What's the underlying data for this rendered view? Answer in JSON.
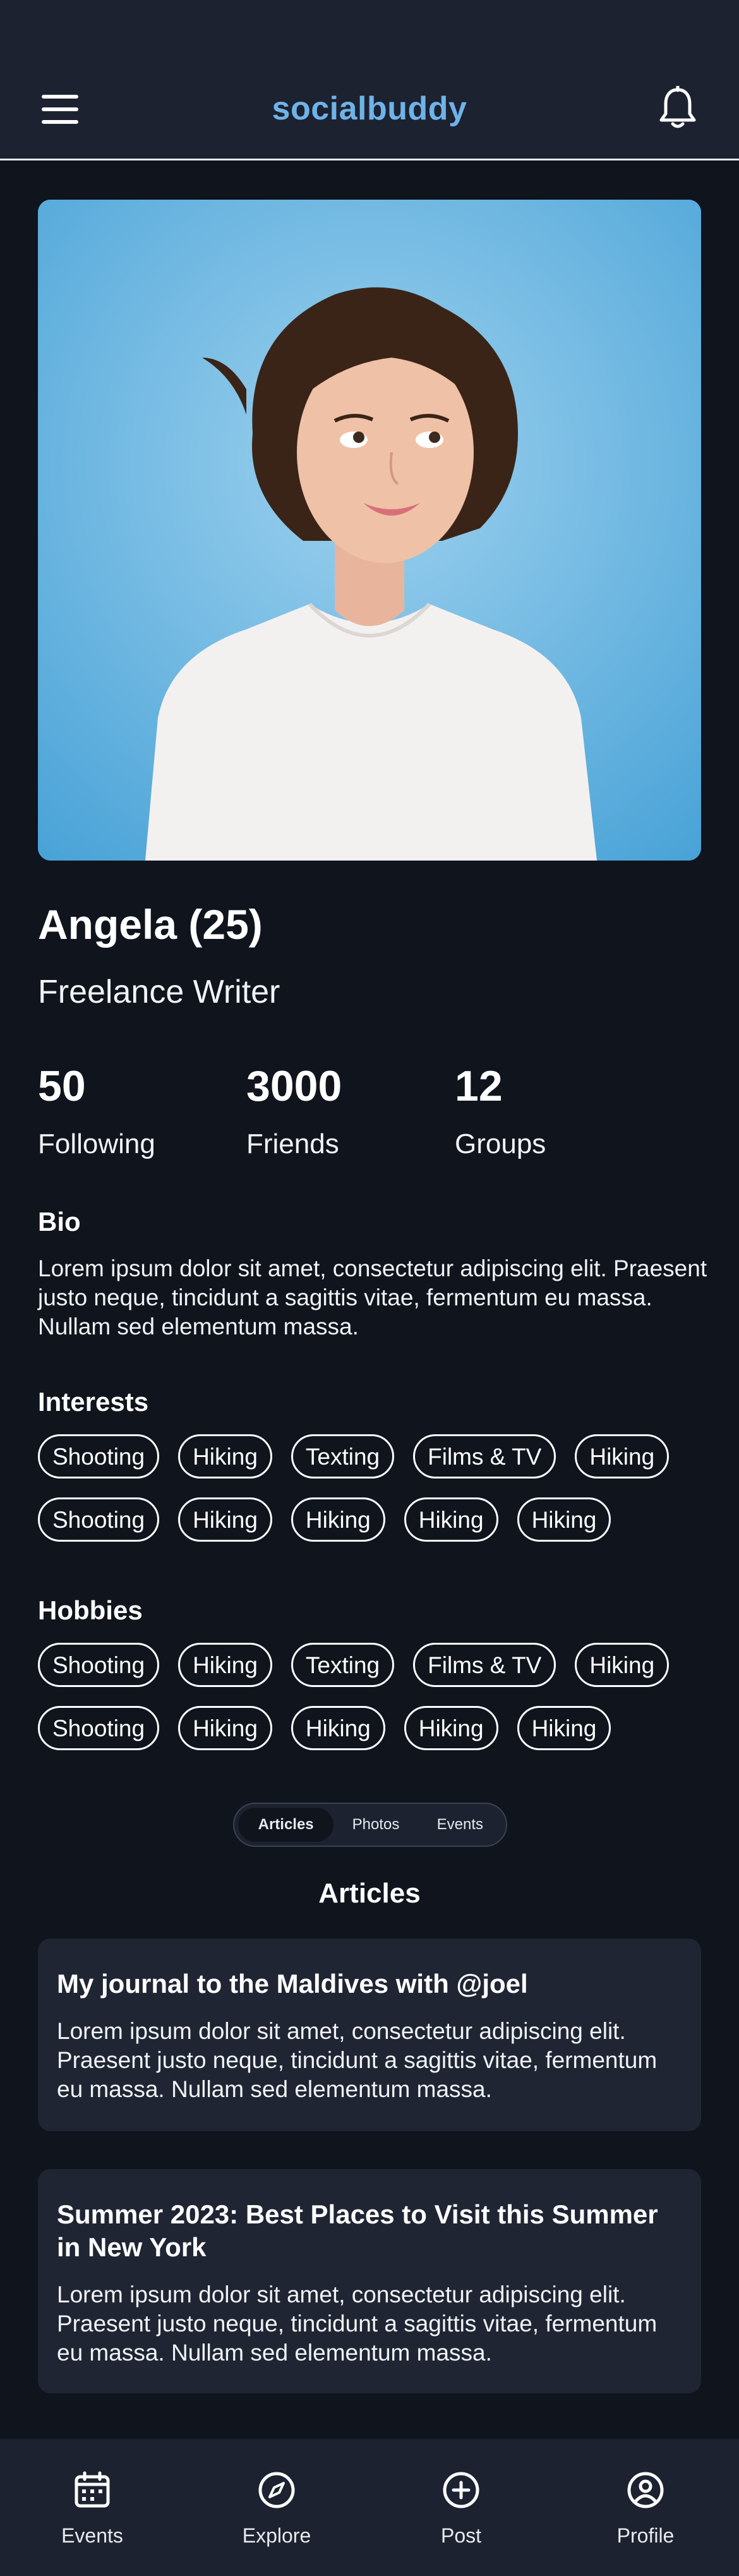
{
  "header": {
    "brand": "socialbuddy",
    "menu_icon": "hamburger-menu-icon",
    "notifications_icon": "bell-icon",
    "brand_color": "#6fb2e8"
  },
  "profile": {
    "name": "Angela (25)",
    "occupation": "Freelance Writer",
    "photo_alt": "profile photo"
  },
  "stats": [
    {
      "value": "50",
      "label": "Following"
    },
    {
      "value": "3000",
      "label": "Friends"
    },
    {
      "value": "12",
      "label": "Groups"
    }
  ],
  "bio": {
    "title": "Bio",
    "text": "Lorem ipsum dolor sit amet, consectetur adipiscing elit. Praesent justo neque, tincidunt a sagittis vitae, fermentum eu massa. Nullam sed elementum massa."
  },
  "interests": {
    "title": "Interests",
    "items": [
      "Shooting",
      "Hiking",
      "Texting",
      "Films & TV",
      "Hiking",
      "Shooting",
      "Hiking",
      "Hiking",
      "Hiking",
      "Hiking"
    ]
  },
  "hobbies": {
    "title": "Hobbies",
    "items": [
      "Shooting",
      "Hiking",
      "Texting",
      "Films & TV",
      "Hiking",
      "Shooting",
      "Hiking",
      "Hiking",
      "Hiking",
      "Hiking"
    ]
  },
  "tabs": {
    "items": [
      "Articles",
      "Photos",
      "Events"
    ],
    "active": "Articles"
  },
  "articles": {
    "heading": "Articles",
    "items": [
      {
        "title": "My journal to the Maldives with @joel",
        "body": "Lorem ipsum dolor sit amet, consectetur adipiscing elit. Praesent justo neque, tincidunt a sagittis vitae, fermentum eu massa. Nullam sed elementum massa."
      },
      {
        "title": "Summer 2023: Best Places to Visit this Summer in New York",
        "body": "Lorem ipsum dolor sit amet, consectetur adipiscing elit. Praesent justo neque, tincidunt a sagittis vitae, fermentum eu massa. Nullam sed elementum massa."
      }
    ]
  },
  "bottom_nav": {
    "items": [
      {
        "label": "Events",
        "icon": "calendar-icon"
      },
      {
        "label": "Explore",
        "icon": "compass-icon"
      },
      {
        "label": "Post",
        "icon": "plus-circle-icon"
      },
      {
        "label": "Profile",
        "icon": "user-circle-icon"
      }
    ]
  }
}
